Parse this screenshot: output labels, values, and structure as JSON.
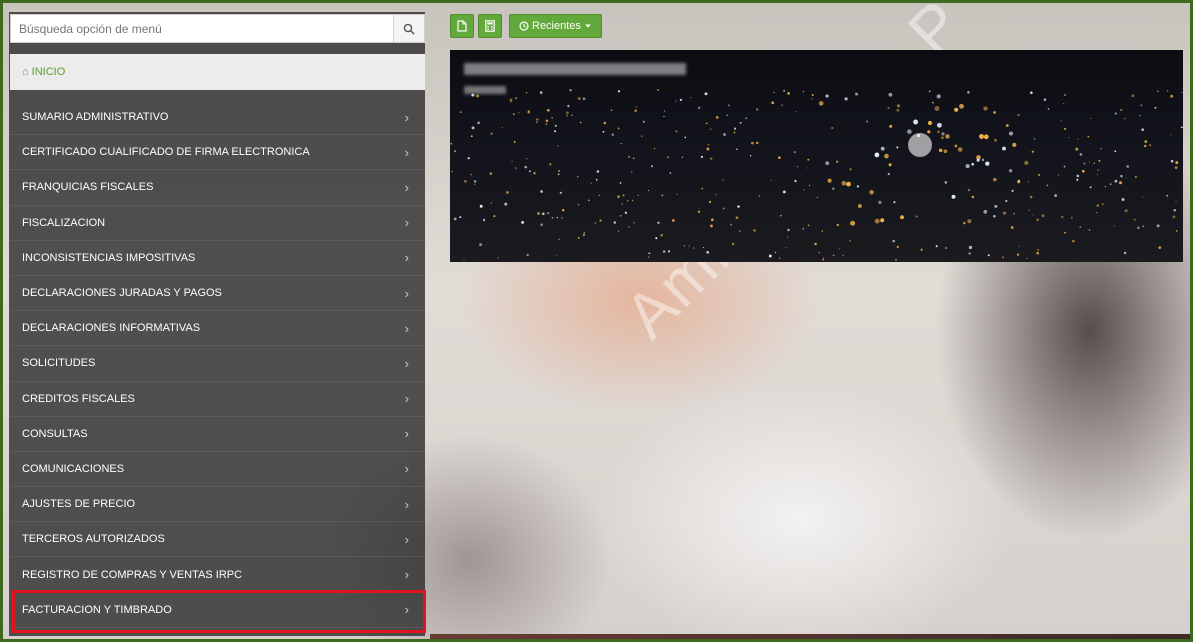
{
  "search": {
    "placeholder": "Búsqueda opción de menú"
  },
  "inicio": {
    "label": "INICIO"
  },
  "menu": {
    "items": [
      {
        "label": "SUMARIO ADMINISTRATIVO"
      },
      {
        "label": "CERTIFICADO CUALIFICADO DE FIRMA ELECTRONICA"
      },
      {
        "label": "FRANQUICIAS FISCALES"
      },
      {
        "label": "FISCALIZACION"
      },
      {
        "label": "INCONSISTENCIAS IMPOSITIVAS"
      },
      {
        "label": "DECLARACIONES JURADAS Y PAGOS"
      },
      {
        "label": "DECLARACIONES INFORMATIVAS"
      },
      {
        "label": "SOLICITUDES"
      },
      {
        "label": "CREDITOS FISCALES"
      },
      {
        "label": "CONSULTAS"
      },
      {
        "label": "COMUNICACIONES"
      },
      {
        "label": "AJUSTES DE PRECIO"
      },
      {
        "label": "TERCEROS AUTORIZADOS"
      },
      {
        "label": "REGISTRO DE COMPRAS Y VENTAS IRPC"
      },
      {
        "label": "FACTURACION Y TIMBRADO"
      }
    ]
  },
  "toolbar": {
    "recientes_label": "Recientes"
  },
  "watermark": {
    "text": "Ambiente de P"
  },
  "colors": {
    "accent": "#62a83a",
    "highlight": "#e0141e",
    "inicio_text": "#5aa02c"
  },
  "icons": [
    "search-icon",
    "home-icon",
    "chevron-right-icon",
    "document-icon",
    "calculator-icon",
    "clock-icon",
    "caret-down-icon"
  ]
}
